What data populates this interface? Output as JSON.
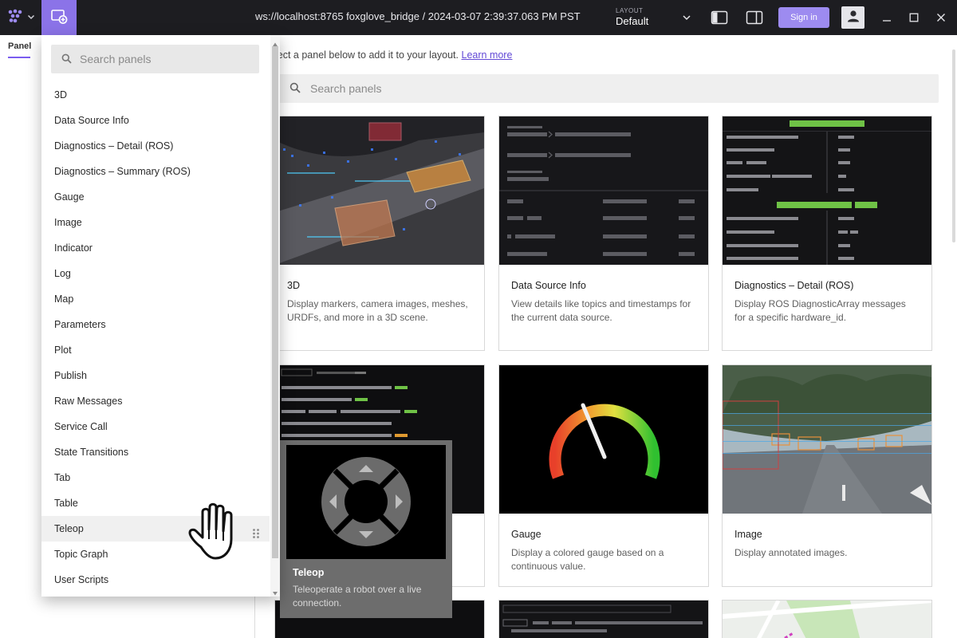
{
  "topbar": {
    "connection": "ws://localhost:8765 foxglove_bridge / 2024-03-07 2:39:37.063 PM PST",
    "layout_label": "LAYOUT",
    "layout_value": "Default",
    "sign_in": "Sign in",
    "accent": "#8b73e8"
  },
  "sidebar": {
    "tab_label": "Panel"
  },
  "main": {
    "intro_text": "lect a panel below to add it to your layout.",
    "learn_more": "Learn more",
    "search_placeholder": "Search panels",
    "cards": [
      {
        "title": "3D",
        "description": "Display markers, camera images, meshes, URDFs, and more in a 3D scene."
      },
      {
        "title": "Data Source Info",
        "description": "View details like topics and timestamps for the current data source."
      },
      {
        "title": "Diagnostics – Detail (ROS)",
        "description": "Display ROS DiagnosticArray messages for a specific hardware_id."
      },
      {
        "title": "Gauge",
        "description": "Display a colored gauge based on a continuous value."
      },
      {
        "title": "Image",
        "description": "Display annotated images."
      }
    ]
  },
  "dropdown": {
    "search_placeholder": "Search panels",
    "items": [
      "3D",
      "Data Source Info",
      "Diagnostics – Detail (ROS)",
      "Diagnostics – Summary (ROS)",
      "Gauge",
      "Image",
      "Indicator",
      "Log",
      "Map",
      "Parameters",
      "Plot",
      "Publish",
      "Raw Messages",
      "Service Call",
      "State Transitions",
      "Tab",
      "Table",
      "Teleop",
      "Topic Graph",
      "User Scripts"
    ],
    "hovered_item": "Teleop"
  },
  "preview": {
    "title": "Teleop",
    "description": "Teleoperate a robot over a live connection."
  }
}
